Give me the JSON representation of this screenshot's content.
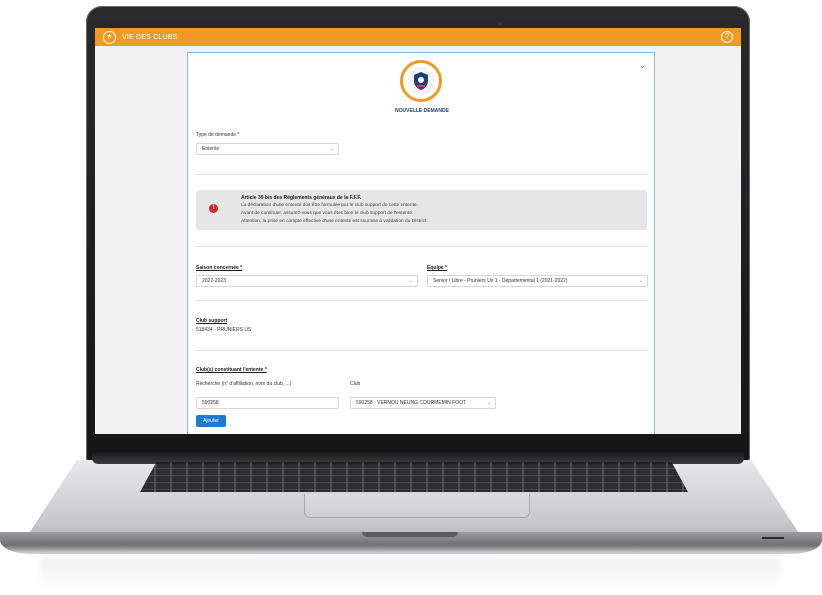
{
  "header": {
    "title": "VIE DES CLUBS",
    "help_icon": "help-icon",
    "color": "#ef9a24"
  },
  "panel": {
    "title": "NOUVELLE DEMANDE",
    "emblem_icon": "fff-emblem-icon",
    "collapse_icon": "chevron-down-icon"
  },
  "request_type": {
    "label": "Type de demande *",
    "value": "Entente"
  },
  "alert": {
    "title": "Article 39 bis des Règlements généraux de la F.F.F.",
    "lines": [
      "La déclaration d'une entente doit être formulée par le club support de cette entente.",
      "Avant de continuer, assurez-vous que vous êtes bien le club support de l'entente.",
      "Attention, la prise en compte effective d'une entente est soumise à validation du District."
    ],
    "icon_color": "#d9232e"
  },
  "season": {
    "label": "Saison concernée *",
    "value": "2022-2023"
  },
  "team": {
    "label": "Equipe *",
    "value": "Senior / Libre - Pruniers Us 1 - Départemental 1 (2021-2022)"
  },
  "support_club": {
    "label": "Club support",
    "value": "518434 - PRUNIERS US"
  },
  "clubs_section": {
    "label": "Club(s) constituant l'entente *",
    "search_label": "Recherche (n° d'affiliation, nom du club, ...)",
    "search_value": "590258",
    "club_label": "Club",
    "club_value": "590258 - VERNOU NEUNG COURMEMIN FOOT",
    "add_button": "Ajouter",
    "button_color": "#1f7ad6"
  }
}
